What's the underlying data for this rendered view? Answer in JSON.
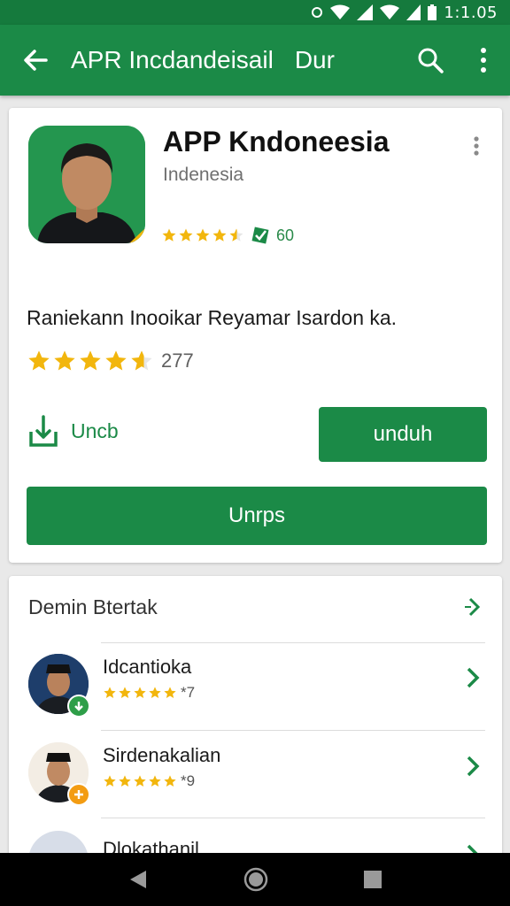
{
  "status_bar": {
    "time": "1:1.05"
  },
  "app_bar": {
    "title": "APR Incdandeisail",
    "title_extra": "Dur"
  },
  "app": {
    "name": "APP Kndoneesia",
    "country": "Indenesia",
    "mini_rating_count": "60",
    "description": "Raniekann Inooikar Reyamar Isardon ka.",
    "rating_count": "277",
    "download_link_label": "Uncb",
    "unduh_button_label": "unduh",
    "wide_button_label": "Unrps"
  },
  "list": {
    "header": "Demin Btertak",
    "items": [
      {
        "title": "Idcantioka",
        "count": "*7",
        "badge_color": "#2e9e48"
      },
      {
        "title": "Sirdenakalian",
        "count": "*9",
        "badge_color": "#f39c12"
      },
      {
        "title": "Dlokathanil"
      }
    ]
  },
  "colors": {
    "primary": "#1b8a47",
    "star": "#f2b60d"
  }
}
